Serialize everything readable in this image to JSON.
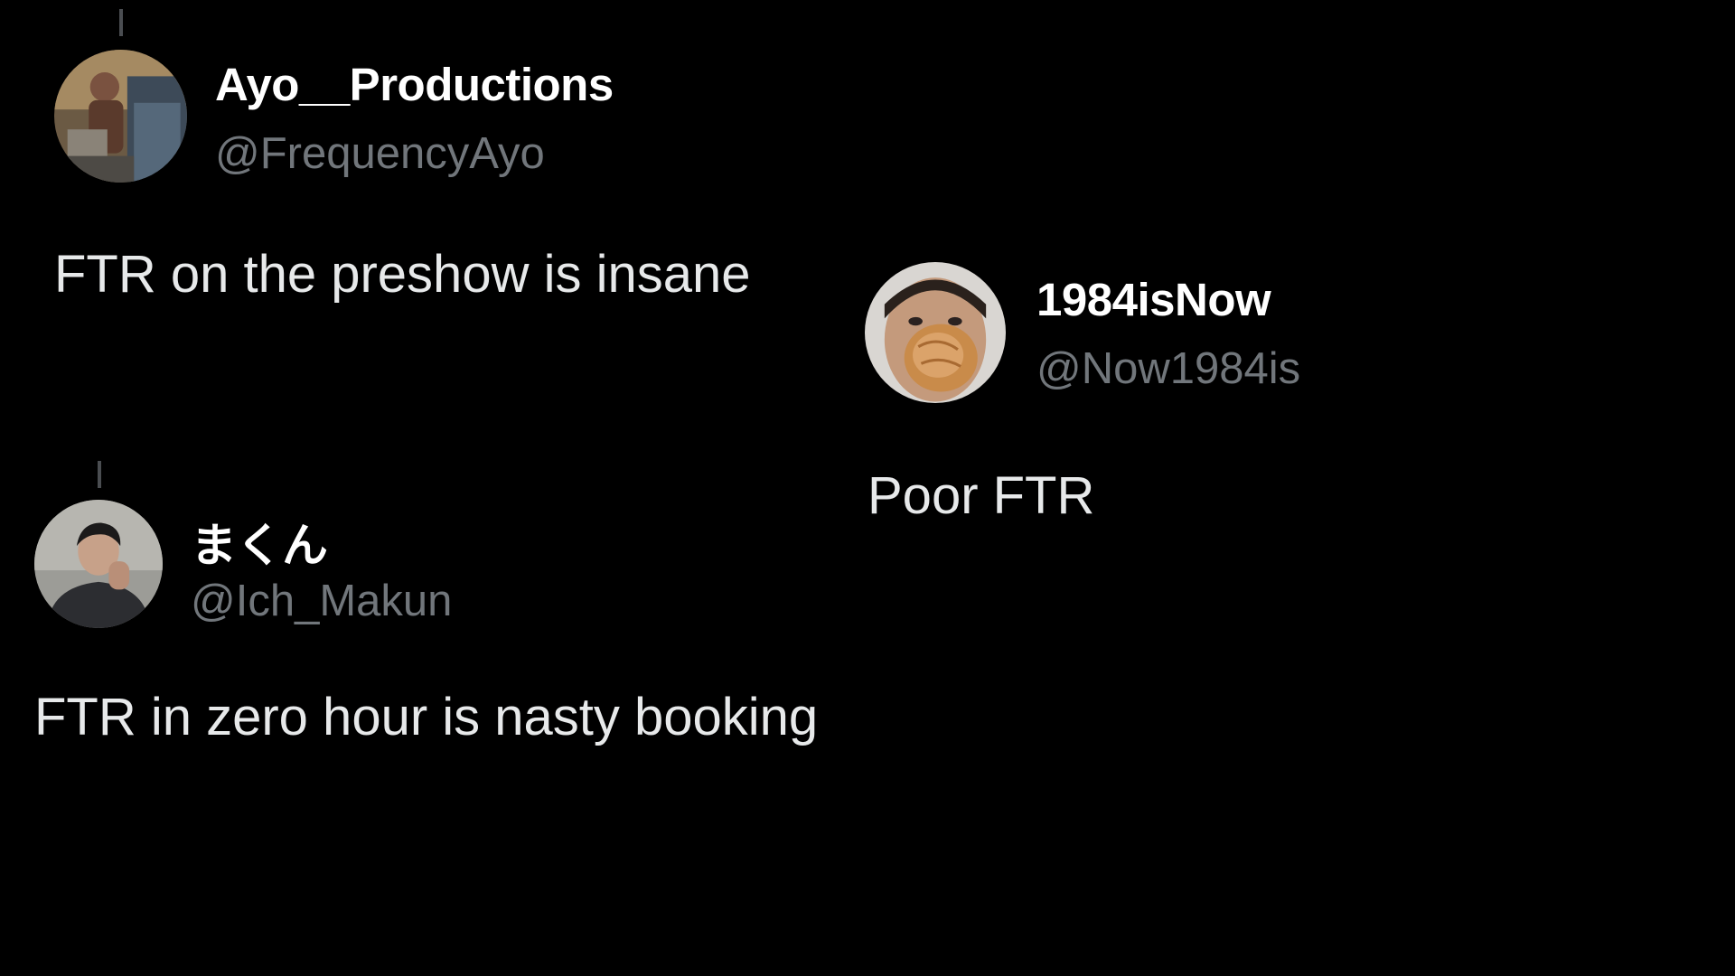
{
  "tweets": [
    {
      "display_name": "Ayo__Productions",
      "handle": "@FrequencyAyo",
      "text": "FTR on the preshow is insane",
      "avatar_icon": "user-photo-avatar"
    },
    {
      "display_name": "1984isNow",
      "handle": "@Now1984is",
      "text": "Poor FTR",
      "avatar_icon": "user-photo-avatar"
    },
    {
      "display_name": "まくん",
      "handle": "@Ich_Makun",
      "text": "FTR in zero hour is nasty booking",
      "avatar_icon": "user-photo-avatar"
    }
  ],
  "colors": {
    "background": "#000000",
    "display_name": "#ffffff",
    "handle": "#71767b",
    "text": "#e7e9ea"
  }
}
